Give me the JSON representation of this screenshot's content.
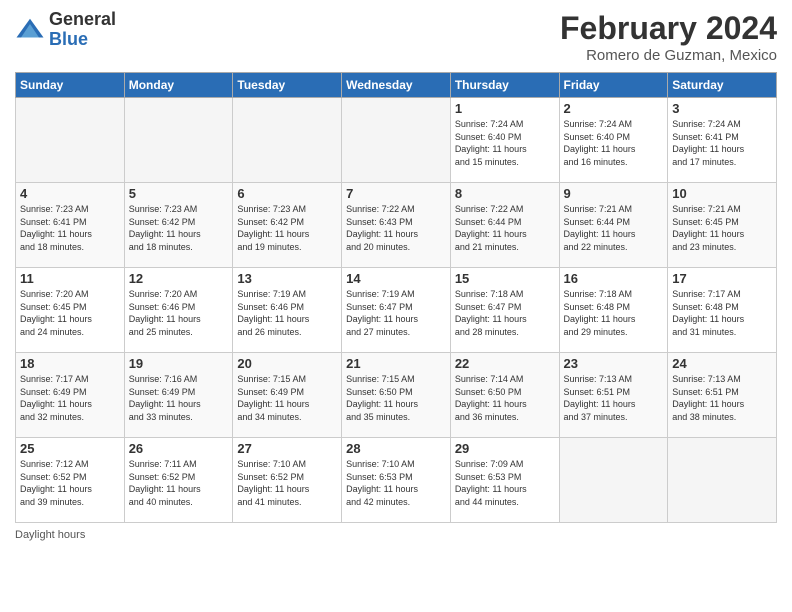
{
  "header": {
    "logo_general": "General",
    "logo_blue": "Blue",
    "month_title": "February 2024",
    "location": "Romero de Guzman, Mexico"
  },
  "days_of_week": [
    "Sunday",
    "Monday",
    "Tuesday",
    "Wednesday",
    "Thursday",
    "Friday",
    "Saturday"
  ],
  "weeks": [
    [
      {
        "day": "",
        "info": ""
      },
      {
        "day": "",
        "info": ""
      },
      {
        "day": "",
        "info": ""
      },
      {
        "day": "",
        "info": ""
      },
      {
        "day": "1",
        "info": "Sunrise: 7:24 AM\nSunset: 6:40 PM\nDaylight: 11 hours\nand 15 minutes."
      },
      {
        "day": "2",
        "info": "Sunrise: 7:24 AM\nSunset: 6:40 PM\nDaylight: 11 hours\nand 16 minutes."
      },
      {
        "day": "3",
        "info": "Sunrise: 7:24 AM\nSunset: 6:41 PM\nDaylight: 11 hours\nand 17 minutes."
      }
    ],
    [
      {
        "day": "4",
        "info": "Sunrise: 7:23 AM\nSunset: 6:41 PM\nDaylight: 11 hours\nand 18 minutes."
      },
      {
        "day": "5",
        "info": "Sunrise: 7:23 AM\nSunset: 6:42 PM\nDaylight: 11 hours\nand 18 minutes."
      },
      {
        "day": "6",
        "info": "Sunrise: 7:23 AM\nSunset: 6:42 PM\nDaylight: 11 hours\nand 19 minutes."
      },
      {
        "day": "7",
        "info": "Sunrise: 7:22 AM\nSunset: 6:43 PM\nDaylight: 11 hours\nand 20 minutes."
      },
      {
        "day": "8",
        "info": "Sunrise: 7:22 AM\nSunset: 6:44 PM\nDaylight: 11 hours\nand 21 minutes."
      },
      {
        "day": "9",
        "info": "Sunrise: 7:21 AM\nSunset: 6:44 PM\nDaylight: 11 hours\nand 22 minutes."
      },
      {
        "day": "10",
        "info": "Sunrise: 7:21 AM\nSunset: 6:45 PM\nDaylight: 11 hours\nand 23 minutes."
      }
    ],
    [
      {
        "day": "11",
        "info": "Sunrise: 7:20 AM\nSunset: 6:45 PM\nDaylight: 11 hours\nand 24 minutes."
      },
      {
        "day": "12",
        "info": "Sunrise: 7:20 AM\nSunset: 6:46 PM\nDaylight: 11 hours\nand 25 minutes."
      },
      {
        "day": "13",
        "info": "Sunrise: 7:19 AM\nSunset: 6:46 PM\nDaylight: 11 hours\nand 26 minutes."
      },
      {
        "day": "14",
        "info": "Sunrise: 7:19 AM\nSunset: 6:47 PM\nDaylight: 11 hours\nand 27 minutes."
      },
      {
        "day": "15",
        "info": "Sunrise: 7:18 AM\nSunset: 6:47 PM\nDaylight: 11 hours\nand 28 minutes."
      },
      {
        "day": "16",
        "info": "Sunrise: 7:18 AM\nSunset: 6:48 PM\nDaylight: 11 hours\nand 29 minutes."
      },
      {
        "day": "17",
        "info": "Sunrise: 7:17 AM\nSunset: 6:48 PM\nDaylight: 11 hours\nand 31 minutes."
      }
    ],
    [
      {
        "day": "18",
        "info": "Sunrise: 7:17 AM\nSunset: 6:49 PM\nDaylight: 11 hours\nand 32 minutes."
      },
      {
        "day": "19",
        "info": "Sunrise: 7:16 AM\nSunset: 6:49 PM\nDaylight: 11 hours\nand 33 minutes."
      },
      {
        "day": "20",
        "info": "Sunrise: 7:15 AM\nSunset: 6:49 PM\nDaylight: 11 hours\nand 34 minutes."
      },
      {
        "day": "21",
        "info": "Sunrise: 7:15 AM\nSunset: 6:50 PM\nDaylight: 11 hours\nand 35 minutes."
      },
      {
        "day": "22",
        "info": "Sunrise: 7:14 AM\nSunset: 6:50 PM\nDaylight: 11 hours\nand 36 minutes."
      },
      {
        "day": "23",
        "info": "Sunrise: 7:13 AM\nSunset: 6:51 PM\nDaylight: 11 hours\nand 37 minutes."
      },
      {
        "day": "24",
        "info": "Sunrise: 7:13 AM\nSunset: 6:51 PM\nDaylight: 11 hours\nand 38 minutes."
      }
    ],
    [
      {
        "day": "25",
        "info": "Sunrise: 7:12 AM\nSunset: 6:52 PM\nDaylight: 11 hours\nand 39 minutes."
      },
      {
        "day": "26",
        "info": "Sunrise: 7:11 AM\nSunset: 6:52 PM\nDaylight: 11 hours\nand 40 minutes."
      },
      {
        "day": "27",
        "info": "Sunrise: 7:10 AM\nSunset: 6:52 PM\nDaylight: 11 hours\nand 41 minutes."
      },
      {
        "day": "28",
        "info": "Sunrise: 7:10 AM\nSunset: 6:53 PM\nDaylight: 11 hours\nand 42 minutes."
      },
      {
        "day": "29",
        "info": "Sunrise: 7:09 AM\nSunset: 6:53 PM\nDaylight: 11 hours\nand 44 minutes."
      },
      {
        "day": "",
        "info": ""
      },
      {
        "day": "",
        "info": ""
      }
    ]
  ],
  "footer": {
    "daylight_label": "Daylight hours"
  }
}
